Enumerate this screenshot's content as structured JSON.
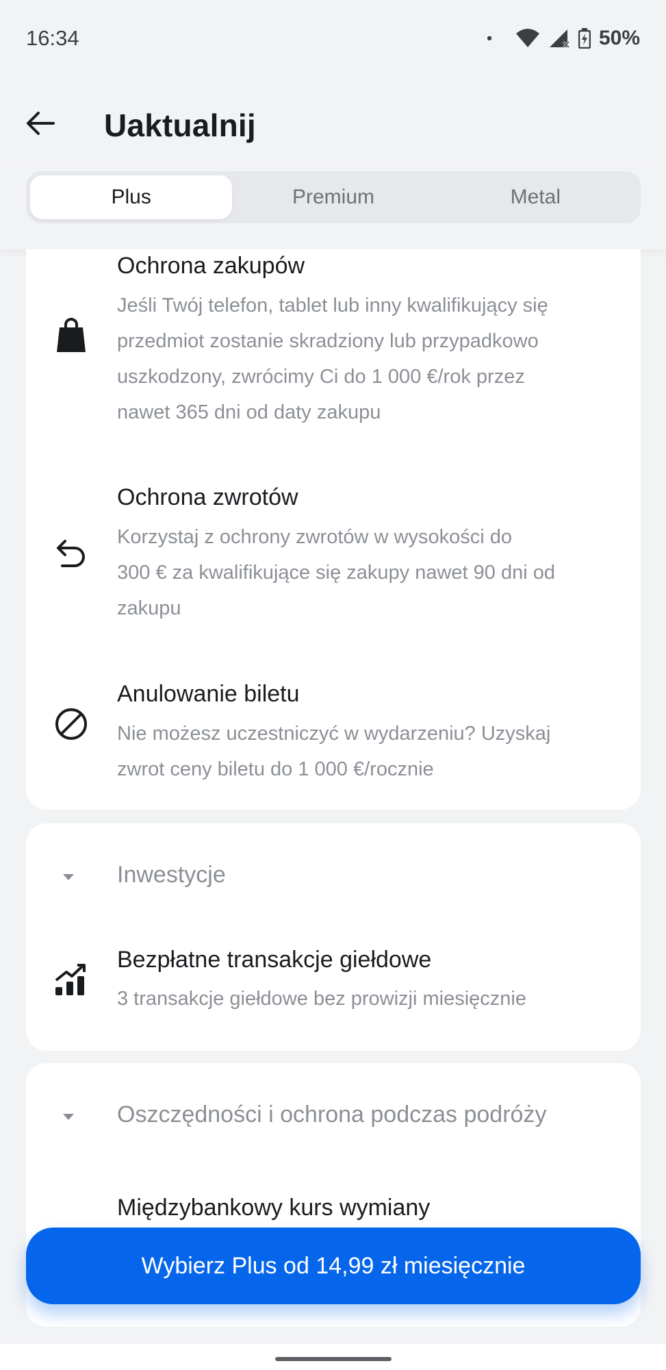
{
  "status_bar": {
    "time": "16:34",
    "dot": "•",
    "battery": "50%",
    "icons": [
      "wifi-icon",
      "signal-icon",
      "battery-icon"
    ]
  },
  "header": {
    "title": "Uaktualnij",
    "back_icon": "arrow-left-icon"
  },
  "tabs": [
    {
      "label": "Plus",
      "active": true
    },
    {
      "label": "Premium",
      "active": false
    },
    {
      "label": "Metal",
      "active": false
    }
  ],
  "protection_card": {
    "features": [
      {
        "icon": "shopping-bag-icon",
        "title": "Ochrona zakupów",
        "desc_lines": [
          "Jeśli Twój telefon, tablet lub inny kwalifikujący się",
          "przedmiot zostanie skradziony lub przypadkowo",
          "uszkodzony, zwrócimy Ci do 1 000 €/rok przez",
          "nawet 365 dni od daty zakupu"
        ]
      },
      {
        "icon": "return-arrow-icon",
        "title": "Ochrona zwrotów",
        "desc_lines": [
          "Korzystaj z ochrony zwrotów w wysokości do",
          "300 € za kwalifikujące się zakupy nawet 90 dni od",
          "zakupu"
        ]
      },
      {
        "icon": "cancel-circle-icon",
        "title": "Anulowanie biletu",
        "desc_lines": [
          "Nie możesz uczestniczyć w wydarzeniu? Uzyskaj",
          "zwrot ceny biletu do 1 000 €/rocznie"
        ]
      }
    ]
  },
  "investments_card": {
    "section_label": "Inwestycje",
    "features": [
      {
        "icon": "stock-chart-icon",
        "title": "Bezpłatne transakcje giełdowe",
        "desc": "3 transakcje giełdowe bez prowizji miesięcznie"
      }
    ]
  },
  "travel_card": {
    "section_label": "Oszczędności i ochrona podczas podróży",
    "features": [
      {
        "title": "Międzybankowy kurs wymiany"
      }
    ]
  },
  "cta": {
    "label": "Wybierz Plus od 14,99 zł miesięcznie"
  },
  "colors": {
    "accent": "#0666eb",
    "background": "#f2f3f5",
    "card": "#ffffff",
    "muted_text": "#8b8f95"
  }
}
